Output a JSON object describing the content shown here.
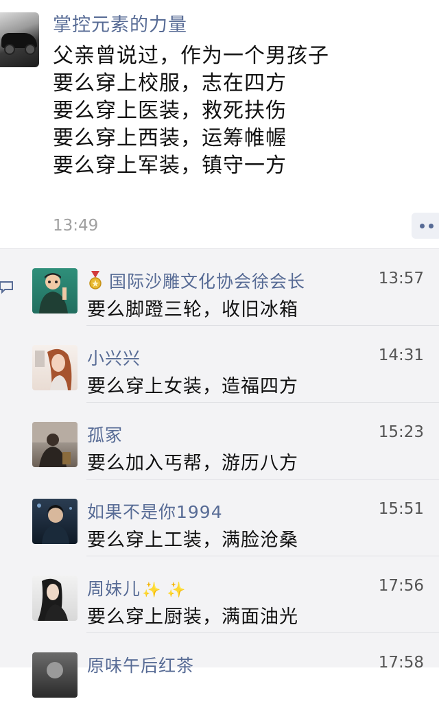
{
  "post": {
    "author": "掌控元素的力量",
    "lines": [
      "父亲曾说过，作为一个男孩子",
      "要么穿上校服，志在四方",
      "要么穿上医装，救死扶伤",
      "要么穿上西装，运筹帷幄",
      "要么穿上军装，镇守一方"
    ],
    "time": "13:49",
    "avatar_icon": "car-icon"
  },
  "comments": [
    {
      "name": "国际沙雕文化协会徐会长",
      "badge_icon": "medal-icon",
      "time": "13:57",
      "text": "要么脚蹬三轮，收旧冰箱"
    },
    {
      "name": "小兴兴",
      "time": "14:31",
      "text": "要么穿上女装，造福四方"
    },
    {
      "name": "孤冢",
      "time": "15:23",
      "text": "要么加入丐帮，游历八方"
    },
    {
      "name": "如果不是你1994",
      "time": "15:51",
      "text": "要么穿上工装，满脸沧桑"
    },
    {
      "name": "周妹儿",
      "name_suffix": "✨ ✨",
      "time": "17:56",
      "text": "要么穿上厨装，满面油光"
    },
    {
      "name": "原味午后红茶",
      "time": "17:58",
      "text": ""
    }
  ],
  "colors": {
    "link": "#576b95",
    "text": "#111111",
    "time": "#a0a0a0",
    "comment_bg": "#f3f3f5"
  }
}
